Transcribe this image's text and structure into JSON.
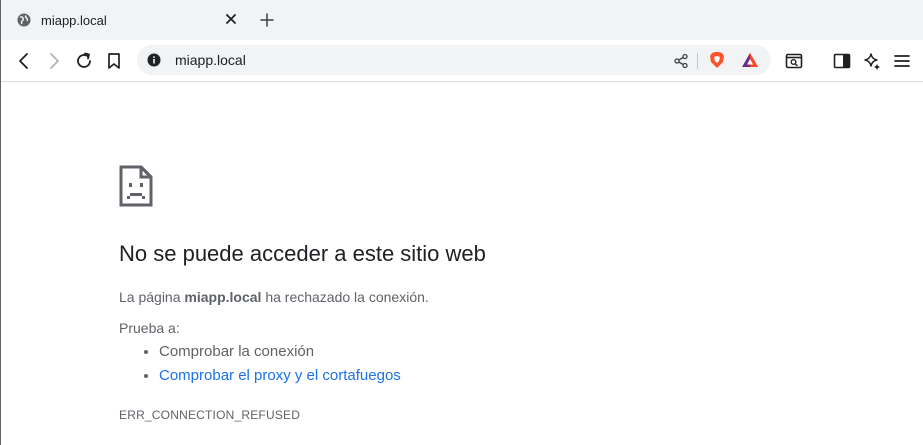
{
  "tab": {
    "title": "miapp.local"
  },
  "toolbar": {
    "url": "miapp.local"
  },
  "error_page": {
    "heading": "No se puede acceder a este sitio web",
    "message_prefix": "La página ",
    "message_host": "miapp.local",
    "message_suffix": " ha rechazado la conexión.",
    "try_label": "Prueba a:",
    "suggestions": [
      {
        "text": "Comprobar la conexión",
        "is_link": false
      },
      {
        "text": "Comprobar el proxy y el cortafuegos",
        "is_link": true
      }
    ],
    "error_code": "ERR_CONNECTION_REFUSED"
  },
  "colors": {
    "link": "#1a73e8",
    "text_secondary": "#5f6368",
    "text_primary": "#202124",
    "brave_orange": "#fb542b"
  },
  "icons": [
    "globe-icon",
    "close-icon",
    "plus-icon",
    "back-icon",
    "forward-icon",
    "reload-icon",
    "bookmark-icon",
    "info-icon",
    "share-icon",
    "brave-shields-icon",
    "brave-rewards-icon",
    "tab-search-icon",
    "sidebar-icon",
    "leo-ai-icon",
    "menu-icon",
    "sad-page-icon"
  ]
}
